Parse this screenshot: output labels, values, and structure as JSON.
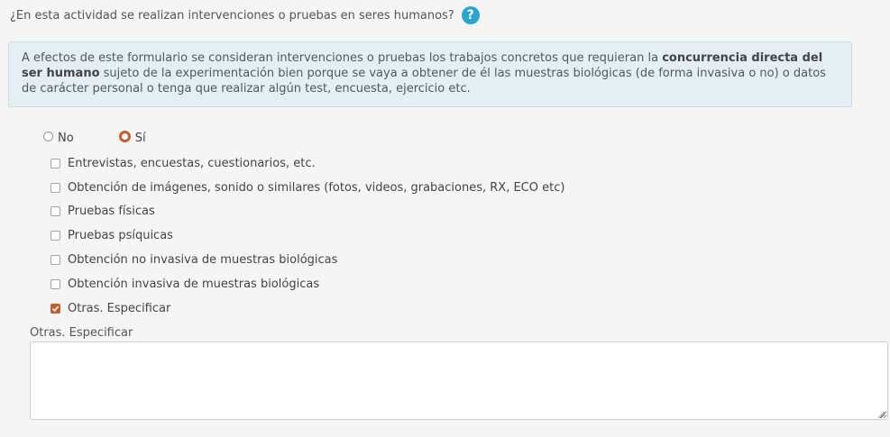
{
  "question": {
    "text": "¿En esta actividad se realizan intervenciones o pruebas en seres humanos?",
    "help_icon": "question-circle-icon",
    "help_glyph": "?"
  },
  "info": {
    "text_before": "A efectos de este formulario se consideran intervenciones o pruebas los trabajos concretos que requieran la ",
    "bold": "concurrencia directa del ser humano",
    "text_after": " sujeto de la experimentación bien porque se vaya a obtener de él las muestras biológicas (de forma invasiva o no) o datos de carácter personal o tenga que realizar algún test, encuesta, ejercicio etc."
  },
  "radios": [
    {
      "label": "No",
      "checked": false
    },
    {
      "label": "Sí",
      "checked": true
    }
  ],
  "checkboxes": [
    {
      "label": "Entrevistas, encuestas, cuestionarios, etc.",
      "checked": false
    },
    {
      "label": "Obtención de imágenes, sonido o similares (fotos, videos, grabaciones, RX, ECO etc)",
      "checked": false
    },
    {
      "label": "Pruebas físicas",
      "checked": false
    },
    {
      "label": "Pruebas psíquicas",
      "checked": false
    },
    {
      "label": "Obtención no invasiva de muestras biológicas",
      "checked": false
    },
    {
      "label": "Obtención invasiva de muestras biológicas",
      "checked": false
    },
    {
      "label": "Otras. Especificar",
      "checked": true
    }
  ],
  "other_field": {
    "label": "Otras. Especificar",
    "value": ""
  },
  "colors": {
    "accent": "#c95b2c",
    "help": "#2aa5cf",
    "info_bg": "#e4eef3"
  }
}
